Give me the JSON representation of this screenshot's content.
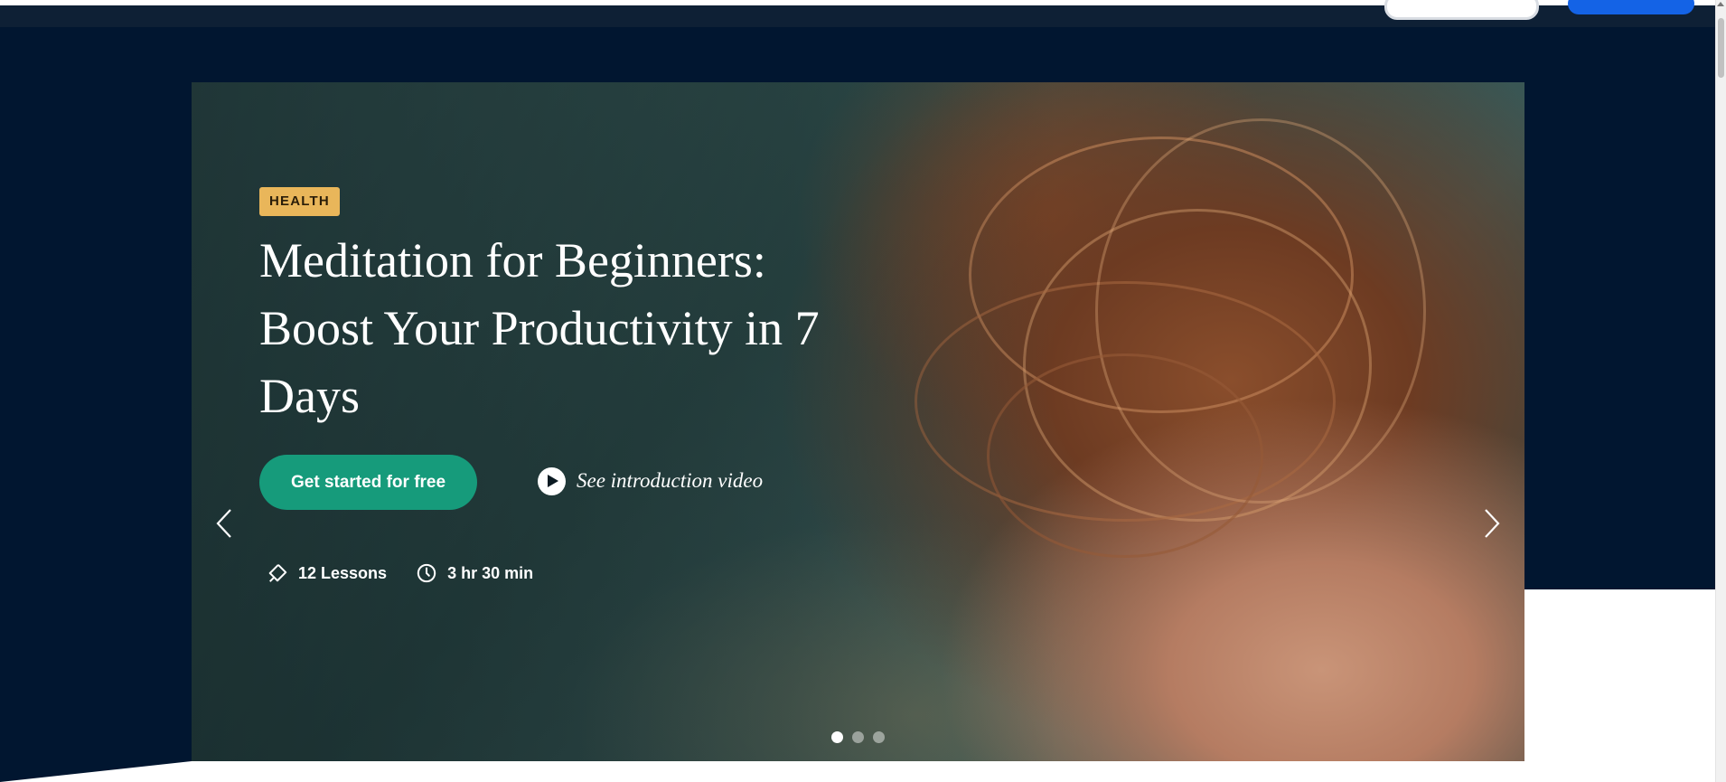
{
  "hero": {
    "badge": "HEALTH",
    "title": "Meditation for Beginners: Boost Your Productivity in 7 Days",
    "cta_label": "Get started for free",
    "video_label": "See introduction video",
    "meta": [
      {
        "icon": "diamond-tag-icon",
        "label": "12 Lessons"
      },
      {
        "icon": "clock-icon",
        "label": "3 hr 30 min"
      }
    ],
    "carousel": {
      "slide_count": 3,
      "active_slide": 1
    }
  },
  "colors": {
    "page_background": "#011630",
    "badge": "#e9b65a",
    "cta": "#169b7b",
    "nav_button": "#1463e6"
  }
}
